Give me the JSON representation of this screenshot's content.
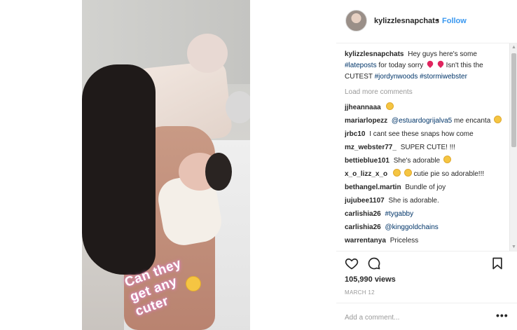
{
  "post": {
    "media_caption": "Can they get any cuter"
  },
  "header": {
    "username": "kylizzlesnapchats",
    "dot": "•",
    "follow_label": "Follow"
  },
  "caption": {
    "username": "kylizzlesnapchats",
    "text_1": "Hey guys here's some",
    "hashtag_1": "#lateposts",
    "text_2": "for today sorry",
    "text_3": "Isn't this the CUTEST",
    "hashtag_2": "#jordynwoods",
    "hashtag_3": "#stormiwebster"
  },
  "load_more_label": "Load more comments",
  "comments": [
    {
      "user": "jjheannaaa",
      "text": ""
    },
    {
      "user": "mariarlopezz",
      "mention": "@estuardogrijalva5",
      "text": "me encanta"
    },
    {
      "user": "jrbc10",
      "text": "I cant see these snaps how come"
    },
    {
      "user": "mz_webster77_",
      "text": "SUPER CUTE! !!!"
    },
    {
      "user": "bettieblue101",
      "text": "She's adorable"
    },
    {
      "user": "x_o_lizz_x_o",
      "text": "cutie pie so adorable!!!"
    },
    {
      "user": "bethangel.martin",
      "text": "Bundle of joy"
    },
    {
      "user": "jujubee1107",
      "text": "She is adorable."
    },
    {
      "user": "carlishia26",
      "mention": "#tygabby",
      "text": ""
    },
    {
      "user": "carlishia26",
      "mention": "@kinggoldchains",
      "text": ""
    },
    {
      "user": "warrentanya",
      "text": "Priceless"
    }
  ],
  "actions": {
    "like_icon": "heart-outline-icon",
    "comment_icon": "speech-bubble-icon",
    "save_icon": "bookmark-icon"
  },
  "stats": {
    "views": "105,990 views",
    "date": "MARCH 12"
  },
  "add_comment": {
    "placeholder": "Add a comment...",
    "more_label": "•••"
  },
  "colors": {
    "link": "#003569",
    "follow": "#3897f0",
    "muted": "#999999"
  }
}
